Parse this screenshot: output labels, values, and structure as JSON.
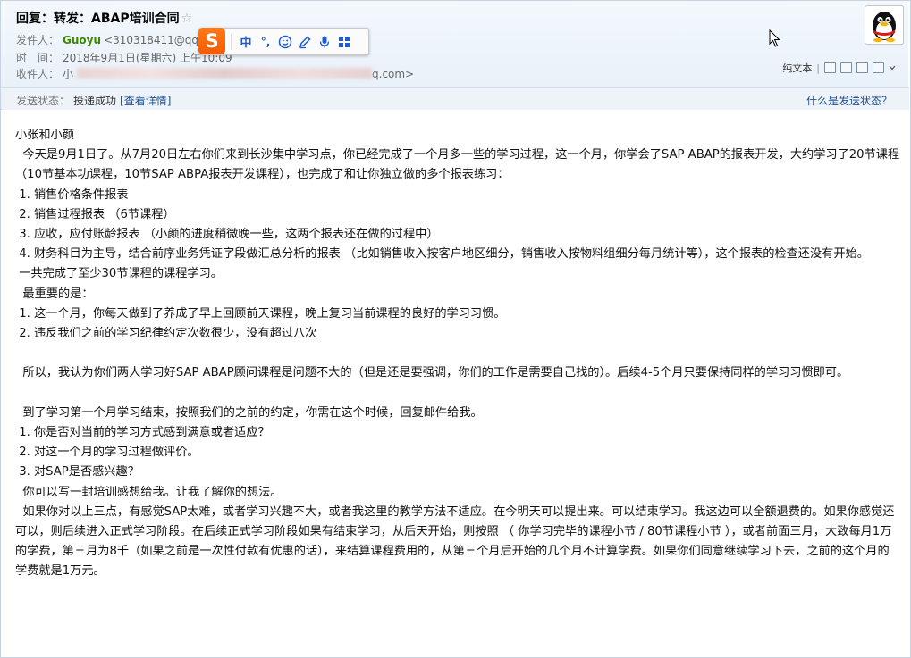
{
  "email": {
    "subject": "回复：转发：ABAP培训合同",
    "star": "☆",
    "from_label": "发件人：",
    "from_name": "Guoyu",
    "from_addr": "<310318411@qq",
    "time_label": "时　间：",
    "time_value": "2018年9月1日(星期六) 上午10:09",
    "to_label": "收件人：",
    "to_prefix": "小",
    "to_suffix": "q.com>",
    "status_label": "发送状态：",
    "status_value": "投递成功",
    "status_link": "[查看详情]",
    "status_help": "什么是发送状态？",
    "plain_text": "纯文本"
  },
  "ime_toolbar": {
    "logo": "S",
    "items": [
      {
        "label": "中",
        "icon": "chinese-mode"
      },
      {
        "label": "°,",
        "icon": "punctuation"
      }
    ]
  },
  "body": [
    "小张和小颜",
    "  今天是9月1日了。从7月20日左右你们来到长沙集中学习点，你已经完成了一个月多一些的学习过程，这一个月，你学会了SAP ABAP的报表开发，大约学习了20节课程（10节基本功课程，10节SAP ABPA报表开发课程），也完成了和让你独立做的多个报表练习：",
    " 1. 销售价格条件报表",
    " 2. 销售过程报表 （6节课程）",
    " 3. 应收，应付账龄报表 （小颜的进度稍微晚一些，这两个报表还在做的过程中）",
    " 4. 财务科目为主导，结合前序业务凭证字段做汇总分析的报表 （比如销售收入按客户地区细分，销售收入按物料组细分每月统计等），这个报表的检查还没有开始。",
    " 一共完成了至少30节课程的课程学习。",
    "  最重要的是：",
    " 1. 这一个月，你每天做到了养成了早上回顾前天课程，晚上复习当前课程的良好的学习习惯。",
    " 2. 违反我们之前的学习纪律约定次数很少，没有超过八次",
    "",
    "  所以，我认为你们两人学习好SAP ABAP顾问课程是问题不大的（但是还是要强调，你们的工作是需要自己找的）。后续4-5个月只要保持同样的学习习惯即可。",
    "",
    "  到了学习第一个月学习结束，按照我们的之前的约定，你需在这个时候，回复邮件给我。",
    " 1. 你是否对当前的学习方式感到满意或者适应？",
    " 2. 对这一个月的学习过程做评价。",
    " 3. 对SAP是否感兴趣？",
    "  你可以写一封培训感想给我。让我了解你的想法。",
    "  如果你对以上三点，有感觉SAP太难，或者学习兴趣不大，或者我这里的教学方法不适应。在今明天可以提出来。可以结束学习。我这边可以全额退费的。如果你感觉还可以，则后续进入正式学习阶段。在后续正式学习阶段如果有结束学习，从后天开始，则按照 （ 你学习完毕的课程小节 / 80节课程小节 ），或者前面三月，大致每月1万的学费，第三月为8千（如果之前是一次性付款有优惠的话），来结算课程费用的，从第三个月后开始的几个月不计算学费。如果你们同意继续学习下去，之前的这个月的学费就是1万元。"
  ]
}
